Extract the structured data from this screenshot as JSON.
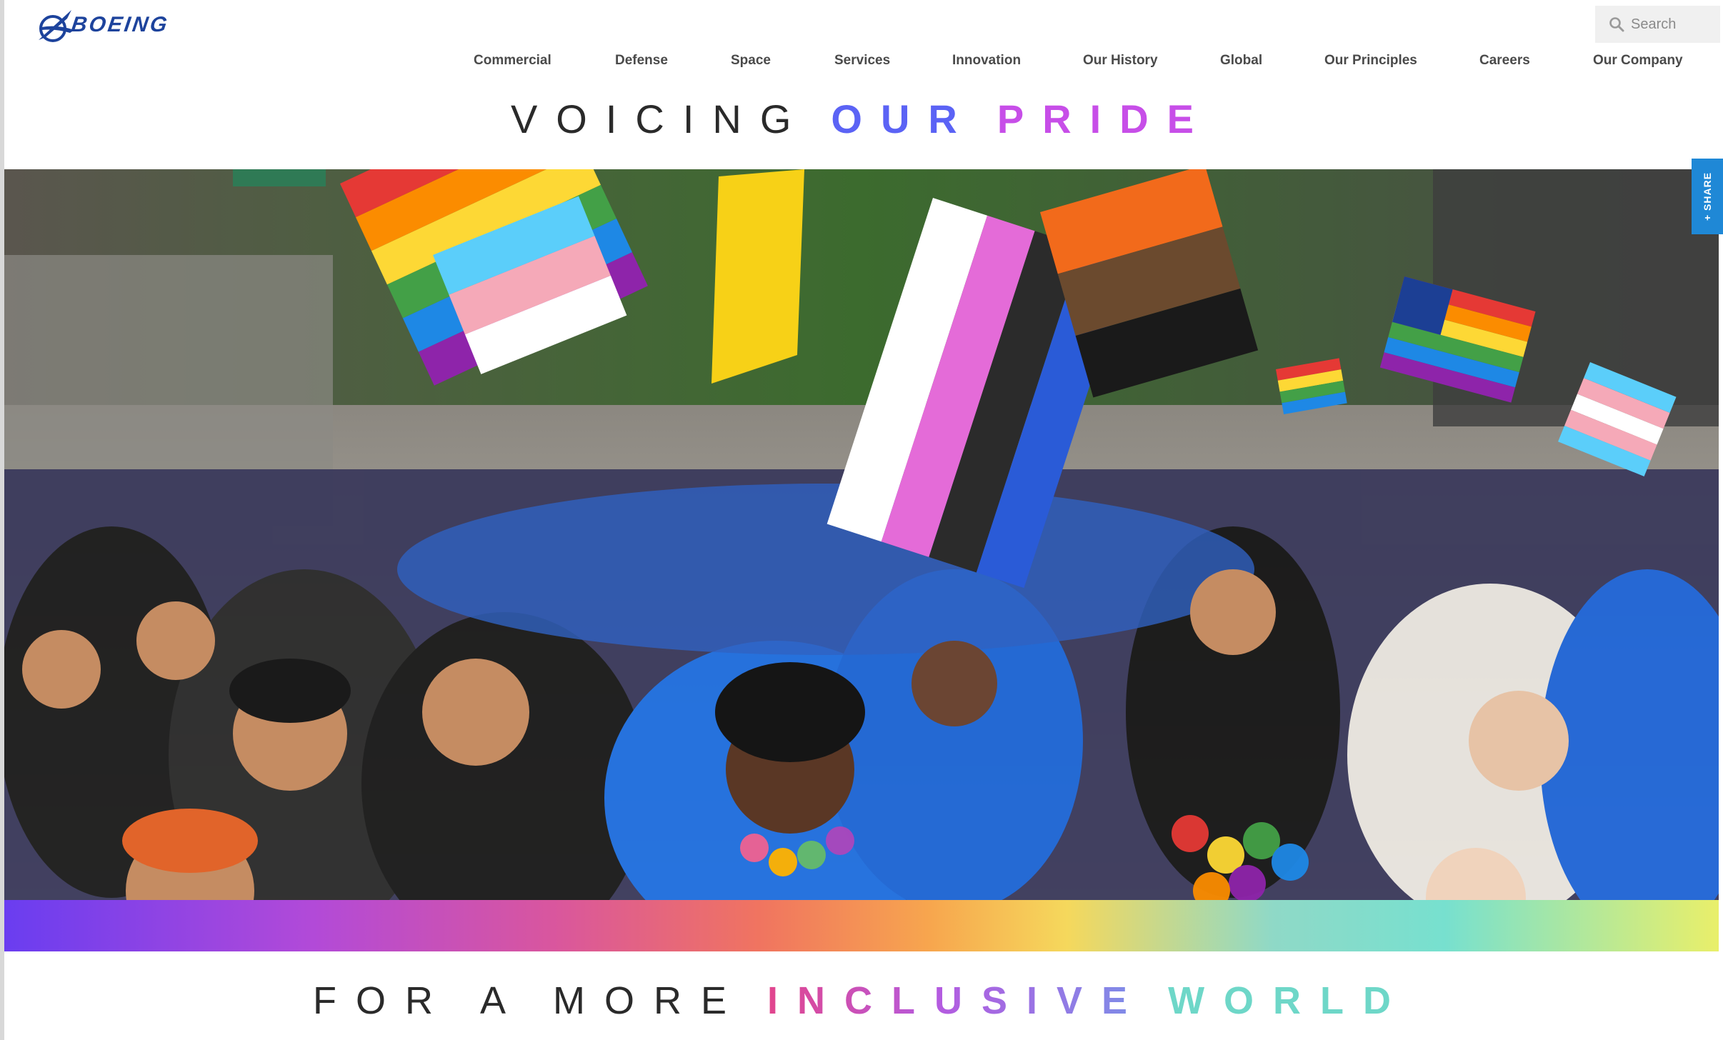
{
  "header": {
    "logo_text": "BOEING",
    "search": {
      "placeholder": "Search",
      "value": ""
    }
  },
  "nav": {
    "items": [
      {
        "label": "Commercial"
      },
      {
        "label": "Defense"
      },
      {
        "label": "Space"
      },
      {
        "label": "Services"
      },
      {
        "label": "Innovation"
      },
      {
        "label": "Our History"
      },
      {
        "label": "Global"
      },
      {
        "label": "Our Principles"
      },
      {
        "label": "Careers"
      },
      {
        "label": "Our Company"
      }
    ]
  },
  "headline": {
    "part1": "VOICING",
    "part2": "OUR",
    "part3": "PRIDE"
  },
  "share": {
    "label": "+ SHARE"
  },
  "tagline": {
    "part1": "FOR A MORE",
    "part2": "INCLUSIVE",
    "part3": "WORLD"
  },
  "colors": {
    "brand_blue": "#1d439c",
    "share_blue": "#1f88d6",
    "headline_our": "#5b63f5",
    "headline_pride": "#c74ee8",
    "tagline_world": "#6ed7c8"
  },
  "icons": {
    "search": "search-icon",
    "logo": "boeing-logo-icon"
  }
}
